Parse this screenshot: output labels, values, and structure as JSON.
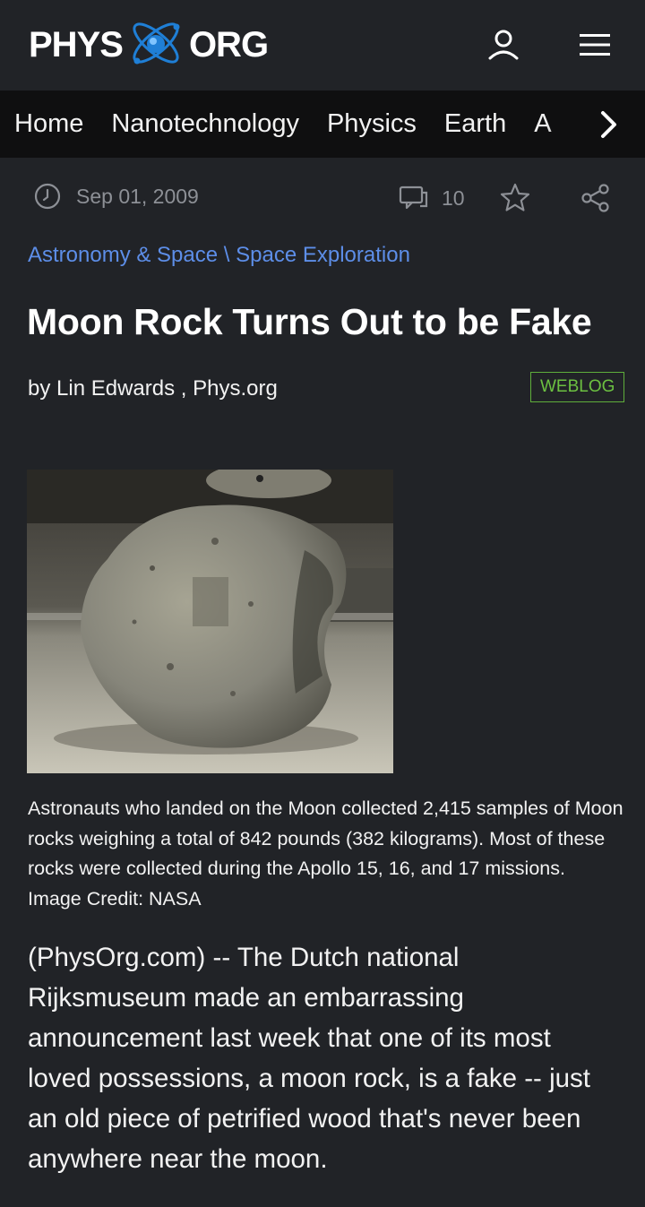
{
  "header": {
    "logo_left": "PHYS",
    "logo_right": "ORG",
    "account_icon": "user-icon",
    "menu_icon": "hamburger-menu-icon"
  },
  "nav": {
    "items": [
      "Home",
      "Nanotechnology",
      "Physics",
      "Earth",
      "A"
    ],
    "more_icon": "chevron-right-icon"
  },
  "meta": {
    "date": "Sep 01, 2009",
    "comment_count": "10",
    "clock_icon": "clock-icon",
    "comment_icon": "comments-icon",
    "bookmark_icon": "star-icon",
    "share_icon": "share-icon"
  },
  "breadcrumb": {
    "category": "Astronomy & Space",
    "separator": "\\",
    "subcategory": "Space Exploration"
  },
  "article": {
    "title": "Moon Rock Turns Out to be Fake",
    "byline": "by Lin Edwards , Phys.org",
    "badge": "WEBLOG",
    "image_caption": "Astronauts who landed on the Moon collected 2,415 samples of Moon rocks weighing a total of 842 pounds (382 kilograms). Most of these rocks were collected during the Apollo 15, 16, and 17 missions. Image Credit: NASA",
    "lead": "(PhysOrg.com) -- The Dutch national Rijksmuseum made an embarrassing announcement last week that one of its most loved possessions, a moon rock, is a fake -- just an old piece of petrified wood that's never been anywhere near the moon."
  },
  "colors": {
    "background": "#212327",
    "nav_background": "#0f0f10",
    "link": "#5d8ee8",
    "badge": "#6cc141",
    "logo_atom": "#1f7fd6"
  }
}
